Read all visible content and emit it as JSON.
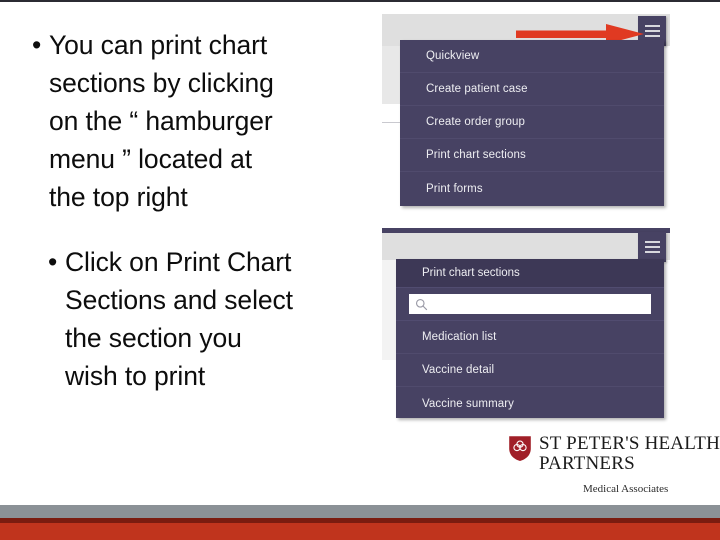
{
  "slide": {
    "bullets": [
      {
        "marker": "•",
        "text": "You can print chart\nsections by clicking\non the “ hamburger\nmenu ” located at\nthe top right"
      },
      {
        "marker": "•",
        "text": "Click on Print Chart\nSections and select\nthe section you\nwish to print"
      }
    ]
  },
  "screenshot_one": {
    "menu_button_icon": "hamburger-menu-icon",
    "annotation_arrow": "red-arrow-right",
    "menu_items": [
      "Quickview",
      "Create patient case",
      "Create order group",
      "Print chart sections",
      "Print forms"
    ]
  },
  "screenshot_two": {
    "menu_button_icon": "hamburger-menu-icon",
    "panel_title": "Print chart sections",
    "search": {
      "icon": "search-icon",
      "value": "",
      "placeholder": ""
    },
    "menu_items": [
      "Medication list",
      "Vaccine detail",
      "Vaccine summary"
    ]
  },
  "logo": {
    "shield_icon": "st-peters-shield-icon",
    "line1": "ST PETER'S HEALTH",
    "line2": "PARTNERS",
    "subtitle": "Medical Associates"
  },
  "colors": {
    "menu_navy": "#474263",
    "panel_header_navy": "#3d3856",
    "toolbar_gray": "#dfdfdf",
    "arrow_red": "#e03a22",
    "band_gray": "#8b9196",
    "band_red": "#c0341d",
    "shield_red": "#a01f28"
  }
}
